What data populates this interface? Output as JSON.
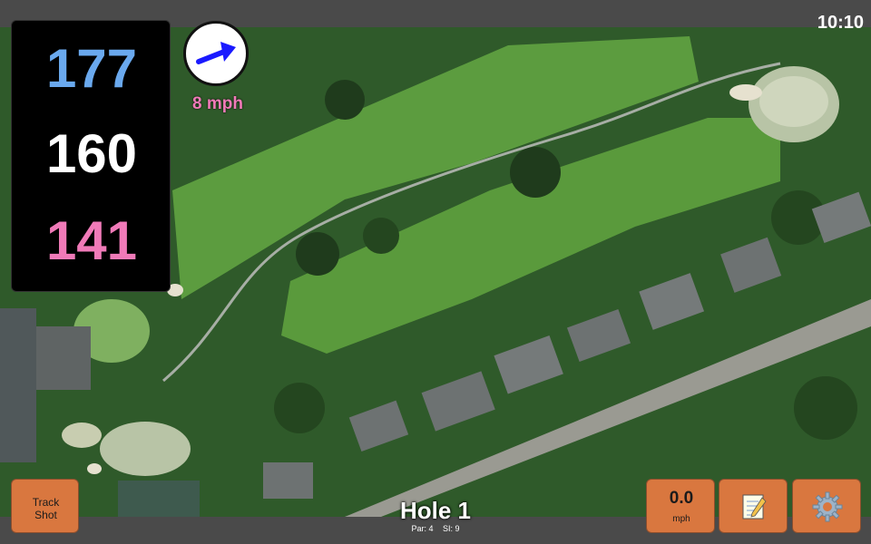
{
  "status": {
    "time": "10:10"
  },
  "yardages": {
    "back": "177",
    "middle": "160",
    "front": "141",
    "colors": {
      "back": "#6aa9ee",
      "middle": "#ffffff",
      "front": "#f07ab8"
    }
  },
  "wind": {
    "speed_label": "8 mph",
    "speed_color": "#f07ab8",
    "arrow_icon": "wind-direction-arrow-icon",
    "arrow_color": "#1a1aff"
  },
  "hole": {
    "title": "Hole 1",
    "par_label": "Par: 4",
    "si_label": "SI: 9"
  },
  "buttons": {
    "track_line1": "Track",
    "track_line2": "Shot",
    "speed_value": "0.0",
    "speed_unit": "mph",
    "notes_icon": "notepad-icon",
    "settings_icon": "gear-icon",
    "color": "#d9773f"
  },
  "map": {
    "fairway_color": "#5fa040",
    "rough_color": "#2f5a2a"
  }
}
